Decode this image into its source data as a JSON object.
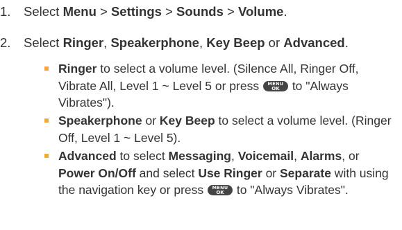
{
  "steps": [
    {
      "number": "1.",
      "parts": [
        "Select ",
        "Menu",
        " > ",
        "Settings",
        " > ",
        "Sounds",
        " > ",
        "Volume",
        "."
      ]
    },
    {
      "number": "2.",
      "parts": [
        "Select ",
        "Ringer",
        ", ",
        "Speakerphone",
        ", ",
        "Key Beep",
        " or ",
        "Advanced",
        "."
      ]
    }
  ],
  "key": {
    "top": "MENU",
    "bottom": "OK"
  },
  "bullets": [
    {
      "parts": [
        "Ringer",
        " to select a volume level. (Silence All, Ringer Off, Vibrate All, Level 1 ~ Level 5 or press ",
        " to \"Always Vibrates\")."
      ]
    },
    {
      "parts": [
        "Speakerphone",
        " or ",
        "Key Beep",
        " to select a volume level. (Ringer Off, Level 1 ~ Level 5)."
      ]
    },
    {
      "parts": [
        "Advanced",
        " to select ",
        "Messaging",
        ", ",
        "Voicemail",
        ", ",
        "Alarms",
        ", or ",
        "Power On/Off",
        " and select ",
        "Use Ringer",
        " or ",
        "Separate",
        " with using the navigation key or press ",
        " to \"Always Vibrates\"."
      ]
    }
  ],
  "colors": {
    "text": "#333333",
    "bullet": "#f2a93b",
    "key_bg": "#444444"
  }
}
